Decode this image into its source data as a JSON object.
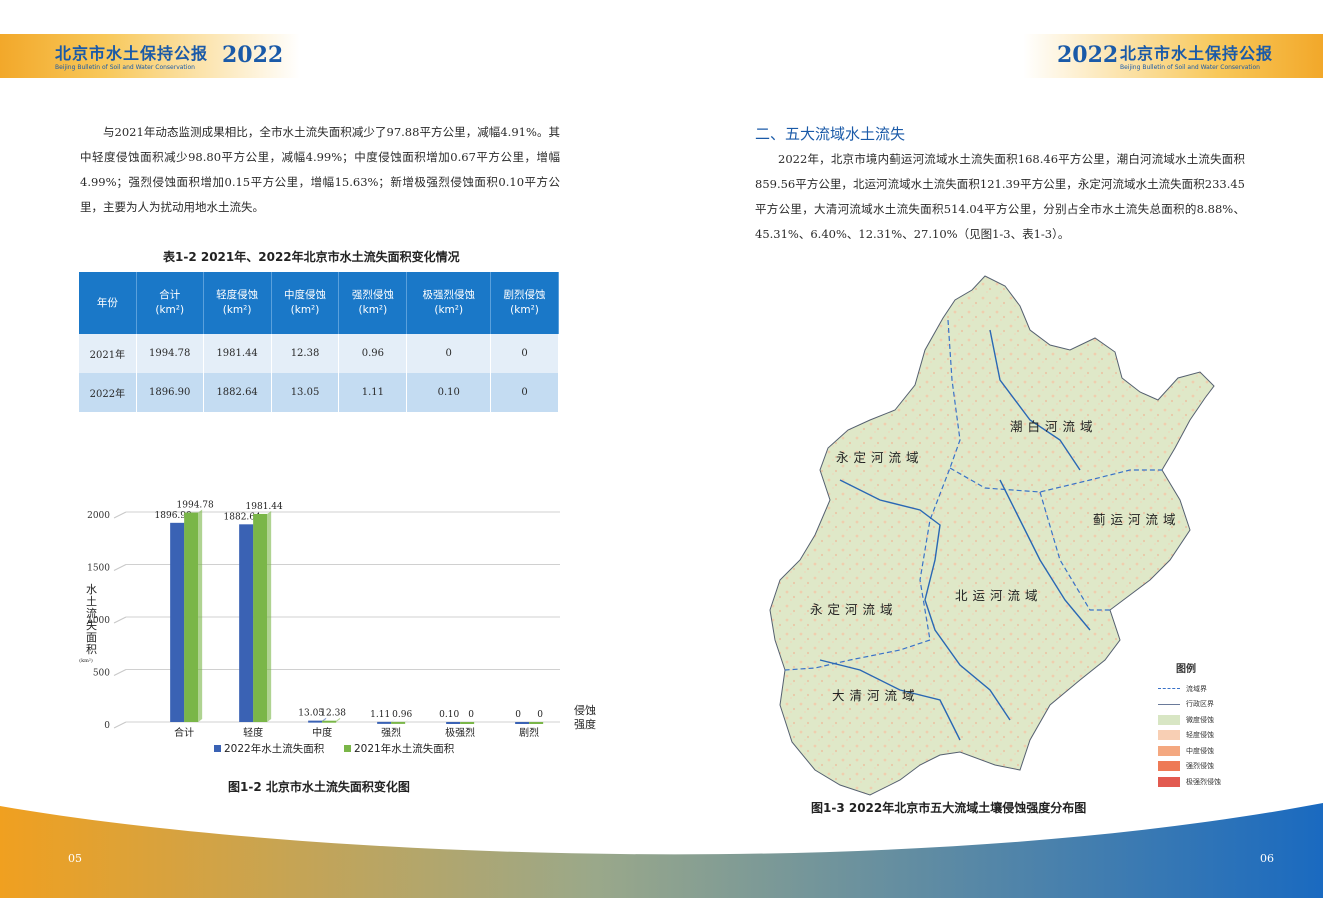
{
  "header": {
    "title_cn": "北京市水土保持公报",
    "title_en": "Beijing Bulletin of Soil and Water Conservation",
    "year": "2022"
  },
  "left": {
    "paragraph": "与2021年动态监测成果相比，全市水土流失面积减少了97.88平方公里，减幅4.91%。其中轻度侵蚀面积减少98.80平方公里，减幅4.99%；中度侵蚀面积增加0.67平方公里，增幅4.99%；强烈侵蚀面积增加0.15平方公里，增幅15.63%；新增极强烈侵蚀面积0.10平方公里，主要为人为扰动用地水土流失。",
    "table_caption": "表1-2  2021年、2022年北京市水土流失面积变化情况",
    "table": {
      "headers": [
        {
          "name": "年份",
          "unit": ""
        },
        {
          "name": "合计",
          "unit": "(km²)"
        },
        {
          "name": "轻度侵蚀",
          "unit": "(km²)"
        },
        {
          "name": "中度侵蚀",
          "unit": "(km²)"
        },
        {
          "name": "强烈侵蚀",
          "unit": "(km²)"
        },
        {
          "name": "极强烈侵蚀",
          "unit": "(km²)"
        },
        {
          "name": "剧烈侵蚀",
          "unit": "(km²)"
        }
      ],
      "rows": [
        [
          "2021年",
          "1994.78",
          "1981.44",
          "12.38",
          "0.96",
          "0",
          "0"
        ],
        [
          "2022年",
          "1896.90",
          "1882.64",
          "13.05",
          "1.11",
          "0.10",
          "0"
        ]
      ]
    },
    "figure_caption": "图1-2 北京市水土流失面积变化图",
    "page_number": "05"
  },
  "chart_data": {
    "type": "bar",
    "categories": [
      "合计",
      "轻度",
      "中度",
      "强烈",
      "极强烈",
      "剧烈"
    ],
    "series": [
      {
        "name": "2022年水土流失面积",
        "values": [
          1896.9,
          1882.64,
          13.05,
          1.11,
          0.1,
          0
        ],
        "labels": [
          "1896.90",
          "1882.64",
          "13.05",
          "1.11",
          "0.10",
          "0"
        ],
        "color": "#3a62b4"
      },
      {
        "name": "2021年水土流失面积",
        "values": [
          1994.78,
          1981.44,
          12.38,
          0.96,
          0,
          0
        ],
        "labels": [
          "1994.78",
          "1981.44",
          "12.38",
          "0.96",
          "0",
          "0"
        ],
        "color": "#7ab648"
      }
    ],
    "ylabel": "水土流失面积",
    "yunit": "(km²)",
    "xlabel": "侵蚀强度",
    "ylim": [
      0,
      2000
    ],
    "yticks": [
      0,
      500,
      1000,
      1500,
      2000
    ],
    "grid": true,
    "legend": "bottom"
  },
  "right": {
    "section_title": "二、五大流域水土流失",
    "paragraph": "2022年，北京市境内蓟运河流域水土流失面积168.46平方公里，潮白河流域水土流失面积859.56平方公里，北运河流域水土流失面积121.39平方公里，永定河流域水土流失面积233.45平方公里，大清河流域水土流失面积514.04平方公里，分别占全市水土流失总面积的8.88%、45.31%、6.40%、12.31%、27.10%（见图1-3、表1-3）。",
    "map_labels": {
      "chaobai": "潮白河流域",
      "yongding_n": "永定河流域",
      "jiyun": "蓟运河流域",
      "beiyun": "北运河流域",
      "yongding_s": "永定河流域",
      "daqing": "大清河流域"
    },
    "legend": {
      "title": "图例",
      "items": [
        {
          "label": "流域界",
          "kind": "dash",
          "color": "#3a72c8"
        },
        {
          "label": "行政区界",
          "kind": "line",
          "color": "#6a7a9a"
        },
        {
          "label": "微度侵蚀",
          "kind": "fill",
          "color": "#d8e6c4"
        },
        {
          "label": "轻度侵蚀",
          "kind": "fill",
          "color": "#f8cfb4"
        },
        {
          "label": "中度侵蚀",
          "kind": "fill",
          "color": "#f4a880"
        },
        {
          "label": "强烈侵蚀",
          "kind": "fill",
          "color": "#ee7a56"
        },
        {
          "label": "极强烈侵蚀",
          "kind": "fill",
          "color": "#e25a50"
        }
      ]
    },
    "figure_caption": "图1-3  2022年北京市五大流域土壤侵蚀强度分布图",
    "page_number": "06"
  }
}
